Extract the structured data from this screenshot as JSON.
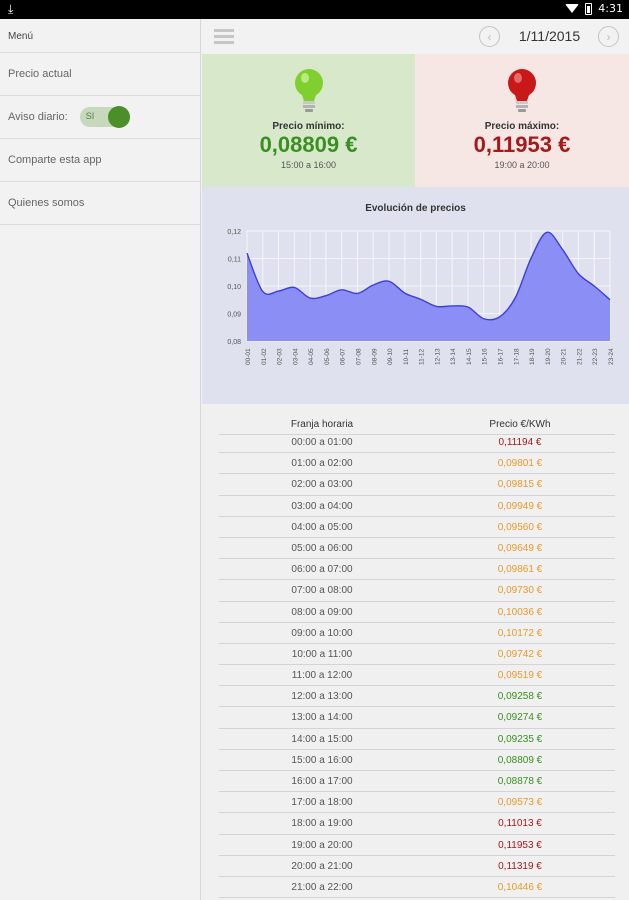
{
  "status_bar": {
    "time": "4:31",
    "download_icon": "download-icon",
    "wifi_icon": "wifi-icon",
    "battery_icon": "battery-icon"
  },
  "sidebar": {
    "title": "Menú",
    "items": [
      {
        "label": "Precio actual"
      },
      {
        "label": "Aviso diario:",
        "toggle_label": "SI",
        "toggle_on": true
      },
      {
        "label": "Comparte esta app"
      },
      {
        "label": "Quienes somos"
      }
    ]
  },
  "header": {
    "date": "1/11/2015",
    "menu_icon": "hamburger-icon",
    "prev_icon": "chevron-left-icon",
    "next_icon": "chevron-right-icon"
  },
  "min_card": {
    "label": "Precio mínimo:",
    "value": "0,08809 €",
    "range": "15:00 a 16:00",
    "color": "#3a8f22",
    "icon": "green-lightbulb-icon"
  },
  "max_card": {
    "label": "Precio máximo:",
    "value": "0,11953 €",
    "range": "19:00 a 20:00",
    "color": "#a41919",
    "icon": "red-lightbulb-icon"
  },
  "chart_data": {
    "type": "area",
    "title": "Evolución de precios",
    "categories": [
      "00-01",
      "01-02",
      "02-03",
      "03-04",
      "04-05",
      "05-06",
      "06-07",
      "07-08",
      "08-09",
      "09-10",
      "10-11",
      "11-12",
      "12-13",
      "13-14",
      "14-15",
      "15-16",
      "16-17",
      "17-18",
      "18-19",
      "19-20",
      "20-21",
      "21-22",
      "22-23",
      "23-24"
    ],
    "values": [
      0.11194,
      0.09801,
      0.09815,
      0.09949,
      0.0956,
      0.09649,
      0.09861,
      0.0973,
      0.10036,
      0.10172,
      0.09742,
      0.09519,
      0.09258,
      0.09274,
      0.09235,
      0.08809,
      0.08878,
      0.09573,
      0.11013,
      0.11953,
      0.11319,
      0.10446,
      0.1,
      0.095
    ],
    "yticks": [
      "0,12",
      "0,11",
      "0,10",
      "0,09",
      "0,08"
    ],
    "ylim": [
      0.08,
      0.12
    ],
    "grid": true,
    "fill_color": "#8b8ff5",
    "line_color": "#3b3fd8"
  },
  "table": {
    "headers": {
      "hour": "Franja horaria",
      "price": "Precio €/KWh"
    },
    "rows": [
      {
        "hour": "00:00 a 01:00",
        "price": "0,11194 €",
        "level": "high"
      },
      {
        "hour": "01:00 a 02:00",
        "price": "0,09801 €",
        "level": "mid"
      },
      {
        "hour": "02:00 a 03:00",
        "price": "0,09815 €",
        "level": "mid"
      },
      {
        "hour": "03:00 a 04:00",
        "price": "0,09949 €",
        "level": "mid"
      },
      {
        "hour": "04:00 a 05:00",
        "price": "0,09560 €",
        "level": "mid"
      },
      {
        "hour": "05:00 a 06:00",
        "price": "0,09649 €",
        "level": "mid"
      },
      {
        "hour": "06:00 a 07:00",
        "price": "0,09861 €",
        "level": "mid"
      },
      {
        "hour": "07:00 a 08:00",
        "price": "0,09730 €",
        "level": "mid"
      },
      {
        "hour": "08:00 a 09:00",
        "price": "0,10036 €",
        "level": "mid"
      },
      {
        "hour": "09:00 a 10:00",
        "price": "0,10172 €",
        "level": "mid"
      },
      {
        "hour": "10:00 a 11:00",
        "price": "0,09742 €",
        "level": "mid"
      },
      {
        "hour": "11:00 a 12:00",
        "price": "0,09519 €",
        "level": "mid"
      },
      {
        "hour": "12:00 a 13:00",
        "price": "0,09258 €",
        "level": "low"
      },
      {
        "hour": "13:00 a 14:00",
        "price": "0,09274 €",
        "level": "low"
      },
      {
        "hour": "14:00 a 15:00",
        "price": "0,09235 €",
        "level": "low"
      },
      {
        "hour": "15:00 a 16:00",
        "price": "0,08809 €",
        "level": "low"
      },
      {
        "hour": "16:00 a 17:00",
        "price": "0,08878 €",
        "level": "low"
      },
      {
        "hour": "17:00 a 18:00",
        "price": "0,09573 €",
        "level": "mid"
      },
      {
        "hour": "18:00 a 19:00",
        "price": "0,11013 €",
        "level": "high"
      },
      {
        "hour": "19:00 a 20:00",
        "price": "0,11953 €",
        "level": "high"
      },
      {
        "hour": "20:00 a 21:00",
        "price": "0,11319 €",
        "level": "high"
      },
      {
        "hour": "21:00 a 22:00",
        "price": "0,10446 €",
        "level": "mid"
      }
    ]
  }
}
